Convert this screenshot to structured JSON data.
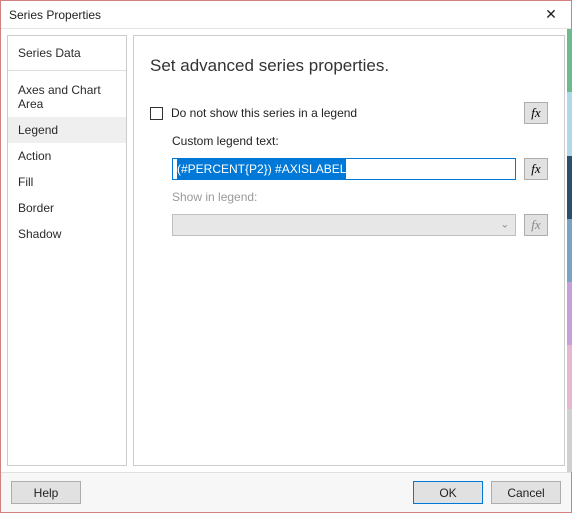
{
  "window": {
    "title": "Series Properties"
  },
  "sidebar": {
    "items": [
      {
        "label": "Series Data"
      },
      {
        "label": "Axes and Chart Area"
      },
      {
        "label": "Legend"
      },
      {
        "label": "Action"
      },
      {
        "label": "Fill"
      },
      {
        "label": "Border"
      },
      {
        "label": "Shadow"
      }
    ]
  },
  "content": {
    "heading": "Set advanced series properties.",
    "hide_legend_label": "Do not show this series in a legend",
    "custom_legend_label": "Custom legend text:",
    "custom_legend_value": "(#PERCENT{P2}) #AXISLABEL",
    "show_in_legend_label": "Show in legend:",
    "show_in_legend_value": "",
    "fx": "fx"
  },
  "footer": {
    "help": "Help",
    "ok": "OK",
    "cancel": "Cancel"
  }
}
